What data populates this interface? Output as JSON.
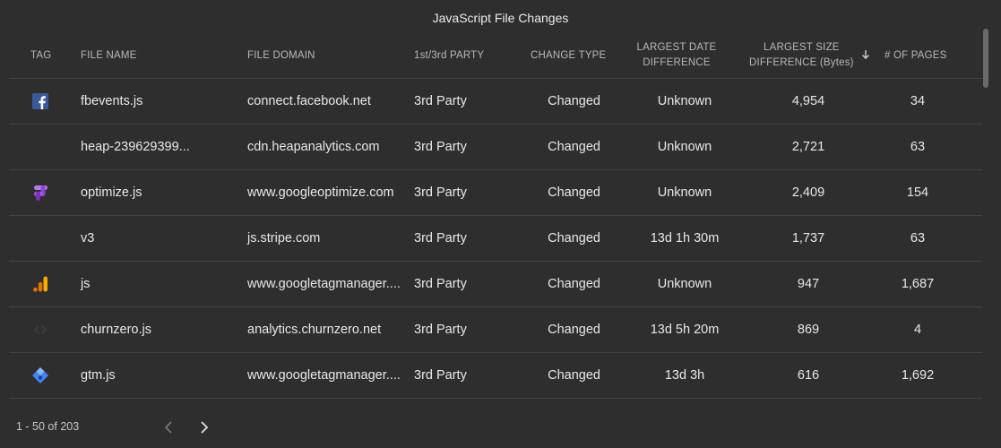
{
  "title": "JavaScript File Changes",
  "columns": {
    "tag": "TAG",
    "file_name": "FILE NAME",
    "file_domain": "FILE DOMAIN",
    "party": "1st/3rd PARTY",
    "change_type": "CHANGE TYPE",
    "date_diff_line1": "LARGEST DATE",
    "date_diff_line2": "DIFFERENCE",
    "size_diff_line1": "LARGEST SIZE",
    "size_diff_line2": "DIFFERENCE (Bytes)",
    "pages": "# OF PAGES"
  },
  "sort_icon": "arrow-down-icon",
  "rows": [
    {
      "tag_icon": "facebook-icon",
      "file_name": "fbevents.js",
      "file_domain": "connect.facebook.net",
      "party": "3rd Party",
      "change_type": "Changed",
      "date_diff": "Unknown",
      "size_diff": "4,954",
      "pages": "34"
    },
    {
      "tag_icon": "",
      "file_name": "heap-239629399...",
      "file_domain": "cdn.heapanalytics.com",
      "party": "3rd Party",
      "change_type": "Changed",
      "date_diff": "Unknown",
      "size_diff": "2,721",
      "pages": "63"
    },
    {
      "tag_icon": "google-optimize-icon",
      "file_name": "optimize.js",
      "file_domain": "www.googleoptimize.com",
      "party": "3rd Party",
      "change_type": "Changed",
      "date_diff": "Unknown",
      "size_diff": "2,409",
      "pages": "154"
    },
    {
      "tag_icon": "",
      "file_name": "v3",
      "file_domain": "js.stripe.com",
      "party": "3rd Party",
      "change_type": "Changed",
      "date_diff": "13d 1h 30m",
      "size_diff": "1,737",
      "pages": "63"
    },
    {
      "tag_icon": "google-analytics-icon",
      "file_name": "js",
      "file_domain": "www.googletagmanager....",
      "party": "3rd Party",
      "change_type": "Changed",
      "date_diff": "Unknown",
      "size_diff": "947",
      "pages": "1,687"
    },
    {
      "tag_icon": "churnzero-icon",
      "file_name": "churnzero.js",
      "file_domain": "analytics.churnzero.net",
      "party": "3rd Party",
      "change_type": "Changed",
      "date_diff": "13d 5h 20m",
      "size_diff": "869",
      "pages": "4"
    },
    {
      "tag_icon": "google-tag-manager-icon",
      "file_name": "gtm.js",
      "file_domain": "www.googletagmanager....",
      "party": "3rd Party",
      "change_type": "Changed",
      "date_diff": "13d 3h",
      "size_diff": "616",
      "pages": "1,692"
    }
  ],
  "pagination": {
    "range": "1 - 50 of 203",
    "prev_icon": "chevron-left-icon",
    "next_icon": "chevron-right-icon"
  },
  "colors": {
    "background": "#2e2e2e",
    "facebook": "#3b5998",
    "optimize": "#a05bd6",
    "analytics_orange": "#f9ab00",
    "analytics_dark": "#e37400",
    "gtm_blue": "#4285f4"
  }
}
